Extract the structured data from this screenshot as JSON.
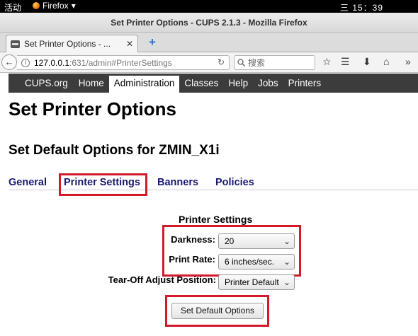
{
  "system_bar": {
    "activities": "活动",
    "app_name": "Firefox",
    "app_menu_arrow": "▾",
    "clock": "三 15：39"
  },
  "window": {
    "title": "Set Printer Options - CUPS 2.1.3 - Mozilla Firefox"
  },
  "browser": {
    "tab_title": "Set Printer Options - ...",
    "tab_close": "✕",
    "new_tab": "+",
    "url_host": "127.0.0.1",
    "url_rest": ":631/admin#PrinterSettings",
    "search_placeholder": "搜索",
    "back_glyph": "←",
    "reload_glyph": "↻",
    "toolbar_icons": {
      "bookmark": "☆",
      "reader": "☰",
      "download": "⬇",
      "home": "⌂",
      "overflow": "»"
    }
  },
  "cups_nav": {
    "items": [
      "CUPS.org",
      "Home",
      "Administration",
      "Classes",
      "Help",
      "Jobs",
      "Printers"
    ],
    "active_index": 2
  },
  "page": {
    "title": "Set Printer Options",
    "subtitle": "Set Default Options for ZMIN_X1i",
    "tabs": [
      "General",
      "Printer Settings",
      "Banners",
      "Policies"
    ],
    "highlighted_tab": "Printer Settings"
  },
  "settings": {
    "heading": "Printer Settings",
    "darkness": {
      "label": "Darkness:",
      "value": "20"
    },
    "print_rate": {
      "label": "Print Rate:",
      "value": "6 inches/sec."
    },
    "tear_off": {
      "label": "Tear-Off Adjust Position:",
      "value": "Printer Default"
    },
    "submit_label": "Set Default Options"
  },
  "colors": {
    "highlight_red": "#d11a2a",
    "nav_bg": "#3c3c3c",
    "tab_link": "#1a1a6e"
  }
}
